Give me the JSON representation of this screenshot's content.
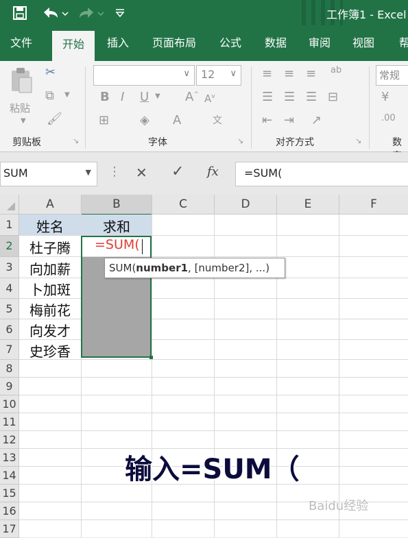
{
  "title_bar": {
    "title": "工作簿1 - Excel",
    "save_icon": "save-icon",
    "undo_icon": "undo-icon",
    "redo_icon": "redo-icon",
    "customize_icon": "customize-qat-icon"
  },
  "tabs": [
    "文件",
    "开始",
    "插入",
    "页面布局",
    "公式",
    "数据",
    "审阅",
    "视图",
    "帮"
  ],
  "active_tab": "开始",
  "ribbon": {
    "clipboard": {
      "label": "剪贴板",
      "paste_label": "粘贴"
    },
    "font": {
      "label": "字体",
      "font_name": "",
      "font_size": "12"
    },
    "alignment": {
      "label": "对齐方式"
    },
    "number": {
      "label": "数字",
      "format": "常规"
    }
  },
  "formula_bar": {
    "name_box": "SUM",
    "cancel_symbol": "✕",
    "enter_symbol": "✓",
    "fx_symbol": "fx",
    "formula": "=SUM("
  },
  "columns": [
    "A",
    "B",
    "C",
    "D",
    "E",
    "F"
  ],
  "rows": [
    "1",
    "2",
    "3",
    "4",
    "5",
    "6",
    "7",
    "8",
    "9",
    "10",
    "11",
    "12",
    "13",
    "14",
    "15",
    "16",
    "17"
  ],
  "cells": {
    "A1": "姓名",
    "B1": "求和",
    "A2": "杜子腾",
    "A3": "向加薪",
    "A4": "卜加斑",
    "A5": "梅前花",
    "A6": "向发才",
    "A7": "史珍香",
    "B2": "=SUM("
  },
  "tooltip": {
    "func": "SUM(",
    "arg1": "number1",
    "rest": ", [number2], ...)"
  },
  "caption": "输入=SUM（",
  "watermark": "Baidu经验",
  "colors": {
    "excel_green": "#217346",
    "formula_red": "#e03c31",
    "selection": "#a6a6a6"
  }
}
